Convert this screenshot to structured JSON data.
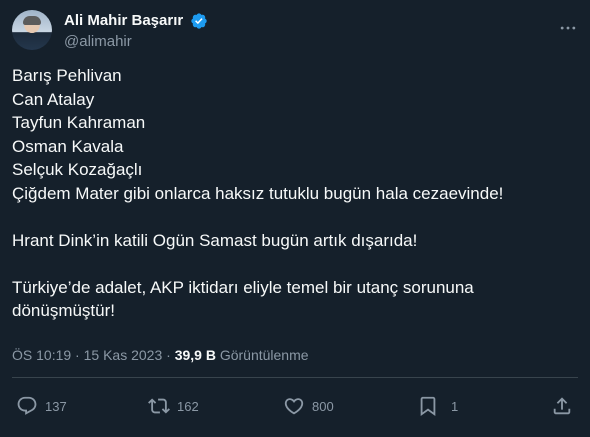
{
  "author": {
    "display_name": "Ali Mahir Başarır",
    "handle": "@alimahir",
    "verified": true
  },
  "tweet": {
    "lines": [
      "Barış Pehlivan",
      "Can Atalay",
      "Tayfun Kahraman",
      "Osman Kavala",
      "Selçuk Kozağaçlı",
      "Çiğdem Mater gibi onlarca haksız tutuklu bugün hala cezaevinde!",
      "",
      "Hrant Dink’in katili Ogün Samast bugün artık dışarıda!",
      "",
      "Türkiye’de adalet, AKP iktidarı eliyle temel bir utanç sorununa",
      "dönüşmüştür!"
    ]
  },
  "meta": {
    "time": "ÖS 10:19",
    "separator": "·",
    "date": "15 Kas 2023",
    "views_count": "39,9 B",
    "views_label": "Görüntülenme"
  },
  "actions": {
    "reply_count": "137",
    "retweet_count": "162",
    "like_count": "800",
    "bookmark_count": "1"
  },
  "colors": {
    "background": "#15202b",
    "text": "#f7f9f9",
    "muted": "#8b98a5",
    "verified": "#1d9bf0",
    "divider": "#38444d"
  }
}
